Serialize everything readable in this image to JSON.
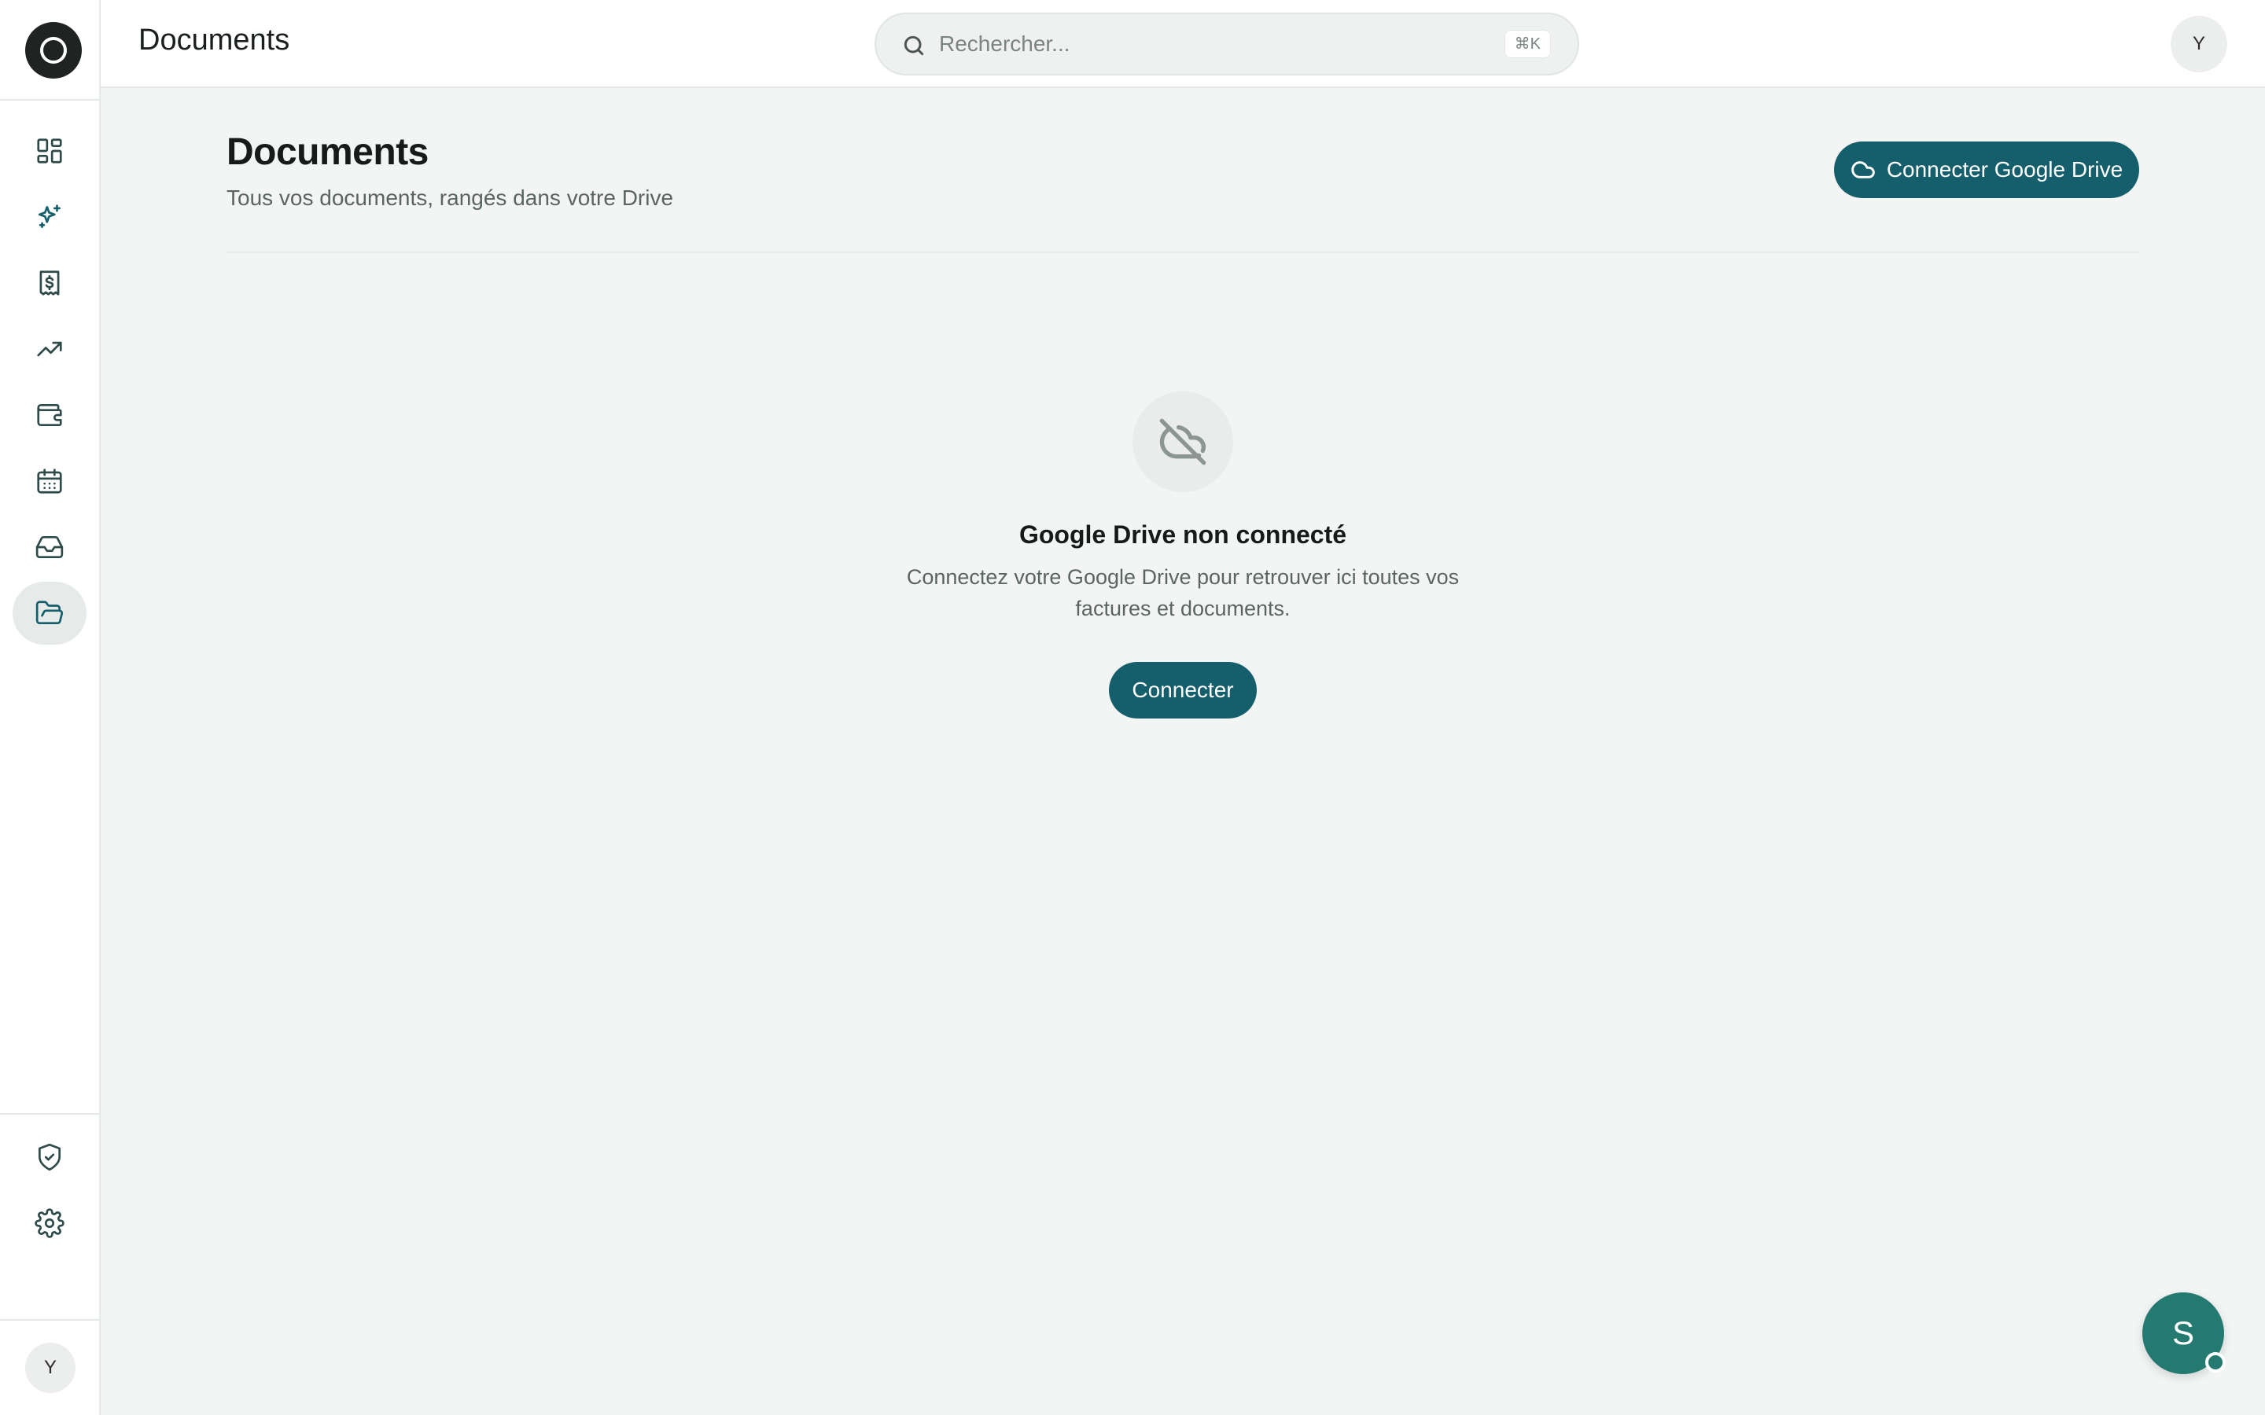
{
  "header": {
    "title": "Documents",
    "search_placeholder": "Rechercher...",
    "search_shortcut": "⌘K",
    "avatar_initial": "Y"
  },
  "sidebar": {
    "items": [
      {
        "name": "dashboard",
        "icon": "grid-icon"
      },
      {
        "name": "ai",
        "icon": "sparkles-icon"
      },
      {
        "name": "invoices",
        "icon": "receipt-dollar-icon"
      },
      {
        "name": "analytics",
        "icon": "trending-up-icon"
      },
      {
        "name": "wallet",
        "icon": "wallet-icon"
      },
      {
        "name": "calendar",
        "icon": "calendar-icon"
      },
      {
        "name": "inbox",
        "icon": "inbox-icon"
      },
      {
        "name": "documents",
        "icon": "folder-open-icon",
        "active": true
      }
    ],
    "bottom_items": [
      {
        "name": "security",
        "icon": "shield-check-icon"
      },
      {
        "name": "settings",
        "icon": "gear-icon"
      }
    ],
    "avatar_initial": "Y"
  },
  "main": {
    "title": "Documents",
    "subtitle": "Tous vos documents, rangés dans votre Drive",
    "connect_drive_label": "Connecter Google Drive",
    "empty_state": {
      "icon": "cloud-off-icon",
      "title": "Google Drive non connecté",
      "description": "Connectez votre Google Drive pour retrouver ici toutes vos factures et documents.",
      "button_label": "Connecter"
    }
  },
  "fab": {
    "initial": "S"
  },
  "colors": {
    "accent": "#155e6b",
    "background": "#f2f5f3",
    "fab": "#247a70"
  }
}
